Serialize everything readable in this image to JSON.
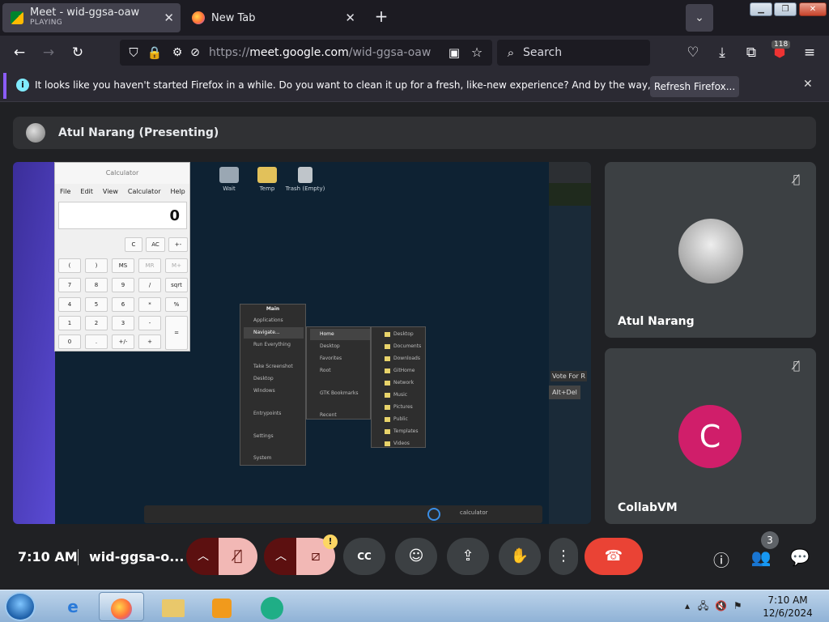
{
  "browser": {
    "tabs": [
      {
        "title": "Meet - wid-ggsa-oaw",
        "subtitle": "PLAYING",
        "favicon": "google-meet-icon",
        "active": true
      },
      {
        "title": "New Tab",
        "subtitle": "",
        "favicon": "firefox-icon",
        "active": false
      }
    ],
    "new_tab_label": "+",
    "url_prefix": "https://",
    "url_host": "meet.google.com",
    "url_path": "/wid-ggsa-oaw",
    "search_placeholder": "Search",
    "extension_badge": "118"
  },
  "notification": {
    "text": "It looks like you haven't started Firefox in a while. Do you want to clean it up for a fresh, like-new experience? And by the way, welcome back!",
    "button": "Refresh Firefox..."
  },
  "meet": {
    "presenting_label": "Atul Narang (Presenting)",
    "participants": [
      {
        "name": "Atul Narang",
        "avatar": "lego-figure-avatar",
        "muted": true
      },
      {
        "name": "CollabVM",
        "initial": "C",
        "avatar_color": "#d01e6a",
        "muted": true
      }
    ],
    "time": "7:10 AM",
    "meeting_code": "wid-ggsa-o...",
    "people_count": "3",
    "camera_warning": "!"
  },
  "shared_screen": {
    "desktop_icons": [
      "Wait",
      "Temp",
      "Trash (Empty)"
    ],
    "calculator": {
      "title": "Calculator",
      "menu": [
        "File",
        "Edit",
        "View",
        "Calculator",
        "Help"
      ],
      "display": "0",
      "keys": [
        [
          "C",
          "AC",
          "+-"
        ],
        [
          "(",
          ")",
          "MS",
          "MR",
          "M+"
        ],
        [
          "7",
          "8",
          "9",
          "/",
          "sqrt"
        ],
        [
          "4",
          "5",
          "6",
          "*",
          "%"
        ],
        [
          "1",
          "2",
          "3",
          "-",
          "="
        ],
        [
          "0",
          ".",
          "+/-",
          "+"
        ]
      ]
    },
    "start_menu": {
      "header": "Main",
      "items": [
        "Applications",
        "Navigate...",
        "Run Everything",
        "Take Screenshot",
        "Desktop",
        "Windows",
        "Entrypoints",
        "Settings",
        "System"
      ],
      "submenu1": [
        "Home",
        "Desktop",
        "Favorites",
        "Root",
        "GTK Bookmarks",
        "Recent"
      ],
      "submenu2": [
        "Desktop",
        "Documents",
        "Downloads",
        "GitHome",
        "Network",
        "Music",
        "Pictures",
        "Public",
        "Templates",
        "Videos"
      ]
    },
    "right_snippets": [
      "Vote For R",
      "Alt+Del"
    ],
    "taskbar_text": "calculator"
  },
  "windows_taskbar": {
    "time": "7:10 AM",
    "date": "12/6/2024"
  }
}
